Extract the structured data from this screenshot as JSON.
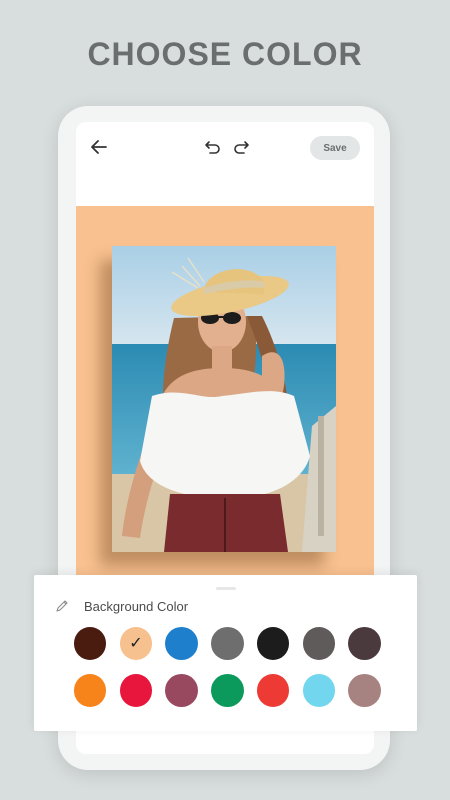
{
  "promo": {
    "title": "CHOOSE COLOR"
  },
  "toolbar": {
    "back_icon": "arrow-left-icon",
    "undo_icon": "undo-icon",
    "redo_icon": "redo-icon",
    "save_label": "Save"
  },
  "canvas": {
    "background_color": "#f9c190"
  },
  "sheet": {
    "title": "Background Color",
    "icon": "pencil-icon",
    "selected_index": 1,
    "colors": [
      [
        "#4a1c10",
        "#f7c08f",
        "#1e7fcd",
        "#6e6e6e",
        "#1c1c1c",
        "#5f5b5a",
        "#4a3a3e"
      ],
      [
        "#f7831b",
        "#e8163d",
        "#98495f",
        "#0c9a5c",
        "#ee3a35",
        "#72d6ee",
        "#a68280"
      ]
    ]
  }
}
